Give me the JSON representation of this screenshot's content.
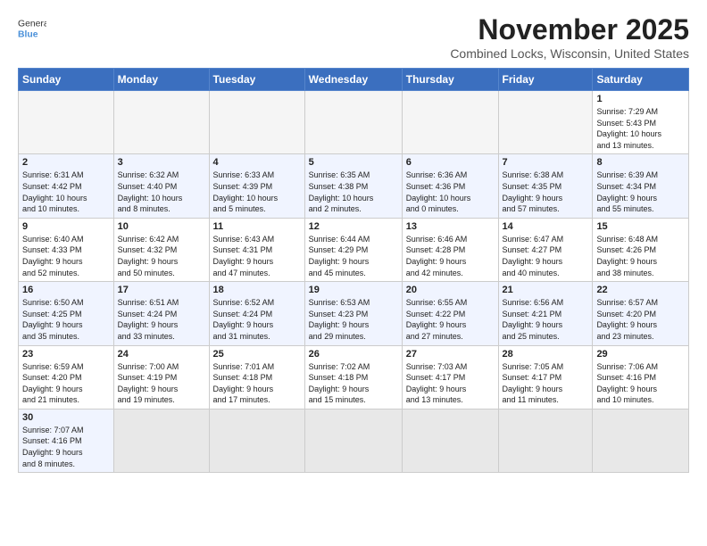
{
  "logo": {
    "line1": "General",
    "line2": "Blue"
  },
  "header": {
    "month": "November 2025",
    "location": "Combined Locks, Wisconsin, United States"
  },
  "days_of_week": [
    "Sunday",
    "Monday",
    "Tuesday",
    "Wednesday",
    "Thursday",
    "Friday",
    "Saturday"
  ],
  "weeks": [
    [
      {
        "day": "",
        "info": ""
      },
      {
        "day": "",
        "info": ""
      },
      {
        "day": "",
        "info": ""
      },
      {
        "day": "",
        "info": ""
      },
      {
        "day": "",
        "info": ""
      },
      {
        "day": "",
        "info": ""
      },
      {
        "day": "1",
        "info": "Sunrise: 7:29 AM\nSunset: 5:43 PM\nDaylight: 10 hours\nand 13 minutes."
      }
    ],
    [
      {
        "day": "2",
        "info": "Sunrise: 6:31 AM\nSunset: 4:42 PM\nDaylight: 10 hours\nand 10 minutes."
      },
      {
        "day": "3",
        "info": "Sunrise: 6:32 AM\nSunset: 4:40 PM\nDaylight: 10 hours\nand 8 minutes."
      },
      {
        "day": "4",
        "info": "Sunrise: 6:33 AM\nSunset: 4:39 PM\nDaylight: 10 hours\nand 5 minutes."
      },
      {
        "day": "5",
        "info": "Sunrise: 6:35 AM\nSunset: 4:38 PM\nDaylight: 10 hours\nand 2 minutes."
      },
      {
        "day": "6",
        "info": "Sunrise: 6:36 AM\nSunset: 4:36 PM\nDaylight: 10 hours\nand 0 minutes."
      },
      {
        "day": "7",
        "info": "Sunrise: 6:38 AM\nSunset: 4:35 PM\nDaylight: 9 hours\nand 57 minutes."
      },
      {
        "day": "8",
        "info": "Sunrise: 6:39 AM\nSunset: 4:34 PM\nDaylight: 9 hours\nand 55 minutes."
      }
    ],
    [
      {
        "day": "9",
        "info": "Sunrise: 6:40 AM\nSunset: 4:33 PM\nDaylight: 9 hours\nand 52 minutes."
      },
      {
        "day": "10",
        "info": "Sunrise: 6:42 AM\nSunset: 4:32 PM\nDaylight: 9 hours\nand 50 minutes."
      },
      {
        "day": "11",
        "info": "Sunrise: 6:43 AM\nSunset: 4:31 PM\nDaylight: 9 hours\nand 47 minutes."
      },
      {
        "day": "12",
        "info": "Sunrise: 6:44 AM\nSunset: 4:29 PM\nDaylight: 9 hours\nand 45 minutes."
      },
      {
        "day": "13",
        "info": "Sunrise: 6:46 AM\nSunset: 4:28 PM\nDaylight: 9 hours\nand 42 minutes."
      },
      {
        "day": "14",
        "info": "Sunrise: 6:47 AM\nSunset: 4:27 PM\nDaylight: 9 hours\nand 40 minutes."
      },
      {
        "day": "15",
        "info": "Sunrise: 6:48 AM\nSunset: 4:26 PM\nDaylight: 9 hours\nand 38 minutes."
      }
    ],
    [
      {
        "day": "16",
        "info": "Sunrise: 6:50 AM\nSunset: 4:25 PM\nDaylight: 9 hours\nand 35 minutes."
      },
      {
        "day": "17",
        "info": "Sunrise: 6:51 AM\nSunset: 4:24 PM\nDaylight: 9 hours\nand 33 minutes."
      },
      {
        "day": "18",
        "info": "Sunrise: 6:52 AM\nSunset: 4:24 PM\nDaylight: 9 hours\nand 31 minutes."
      },
      {
        "day": "19",
        "info": "Sunrise: 6:53 AM\nSunset: 4:23 PM\nDaylight: 9 hours\nand 29 minutes."
      },
      {
        "day": "20",
        "info": "Sunrise: 6:55 AM\nSunset: 4:22 PM\nDaylight: 9 hours\nand 27 minutes."
      },
      {
        "day": "21",
        "info": "Sunrise: 6:56 AM\nSunset: 4:21 PM\nDaylight: 9 hours\nand 25 minutes."
      },
      {
        "day": "22",
        "info": "Sunrise: 6:57 AM\nSunset: 4:20 PM\nDaylight: 9 hours\nand 23 minutes."
      }
    ],
    [
      {
        "day": "23",
        "info": "Sunrise: 6:59 AM\nSunset: 4:20 PM\nDaylight: 9 hours\nand 21 minutes."
      },
      {
        "day": "24",
        "info": "Sunrise: 7:00 AM\nSunset: 4:19 PM\nDaylight: 9 hours\nand 19 minutes."
      },
      {
        "day": "25",
        "info": "Sunrise: 7:01 AM\nSunset: 4:18 PM\nDaylight: 9 hours\nand 17 minutes."
      },
      {
        "day": "26",
        "info": "Sunrise: 7:02 AM\nSunset: 4:18 PM\nDaylight: 9 hours\nand 15 minutes."
      },
      {
        "day": "27",
        "info": "Sunrise: 7:03 AM\nSunset: 4:17 PM\nDaylight: 9 hours\nand 13 minutes."
      },
      {
        "day": "28",
        "info": "Sunrise: 7:05 AM\nSunset: 4:17 PM\nDaylight: 9 hours\nand 11 minutes."
      },
      {
        "day": "29",
        "info": "Sunrise: 7:06 AM\nSunset: 4:16 PM\nDaylight: 9 hours\nand 10 minutes."
      }
    ],
    [
      {
        "day": "30",
        "info": "Sunrise: 7:07 AM\nSunset: 4:16 PM\nDaylight: 9 hours\nand 8 minutes."
      },
      {
        "day": "",
        "info": ""
      },
      {
        "day": "",
        "info": ""
      },
      {
        "day": "",
        "info": ""
      },
      {
        "day": "",
        "info": ""
      },
      {
        "day": "",
        "info": ""
      },
      {
        "day": "",
        "info": ""
      }
    ]
  ]
}
